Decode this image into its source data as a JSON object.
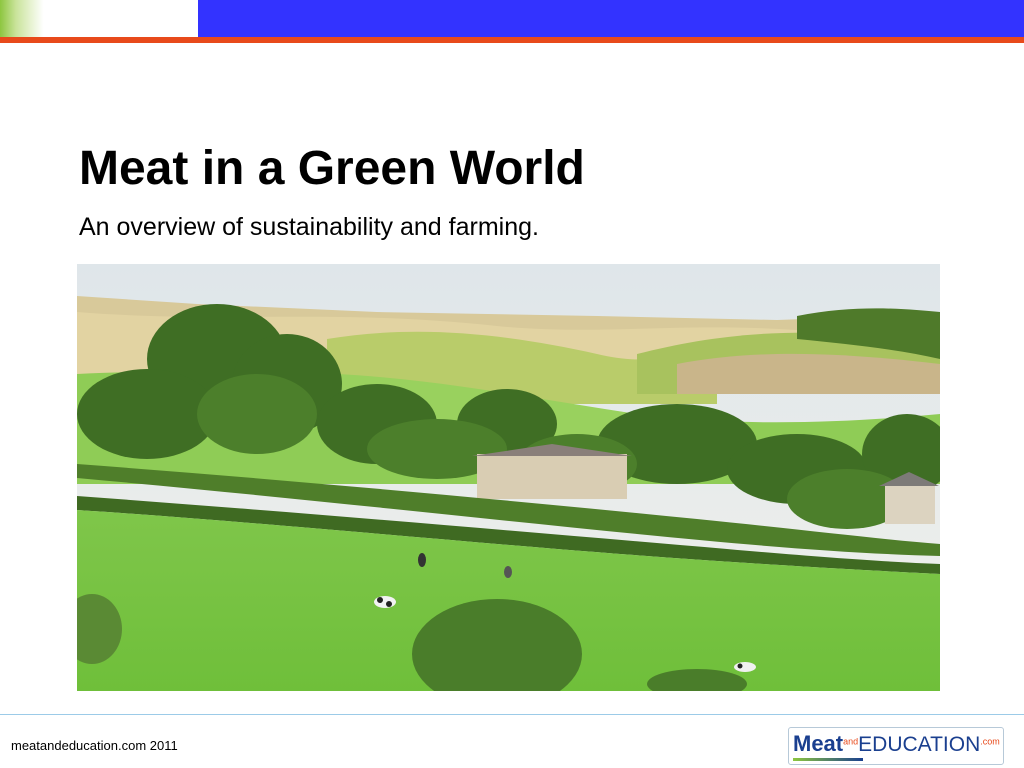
{
  "slide": {
    "title": "Meat in a Green World",
    "subtitle": "An overview of sustainability and farming."
  },
  "photo": {
    "description_icon": "countryside-photo"
  },
  "footer": {
    "credit": "meatandeducation.com 2011",
    "logo": {
      "meat": "Meat",
      "and": "and",
      "education": "EDUCATION",
      "com": ".com"
    }
  },
  "colors": {
    "top_blue": "#3333ff",
    "top_red": "#e84a1b",
    "top_green": "#8dc63f",
    "brand_navy": "#1a3f8f"
  }
}
